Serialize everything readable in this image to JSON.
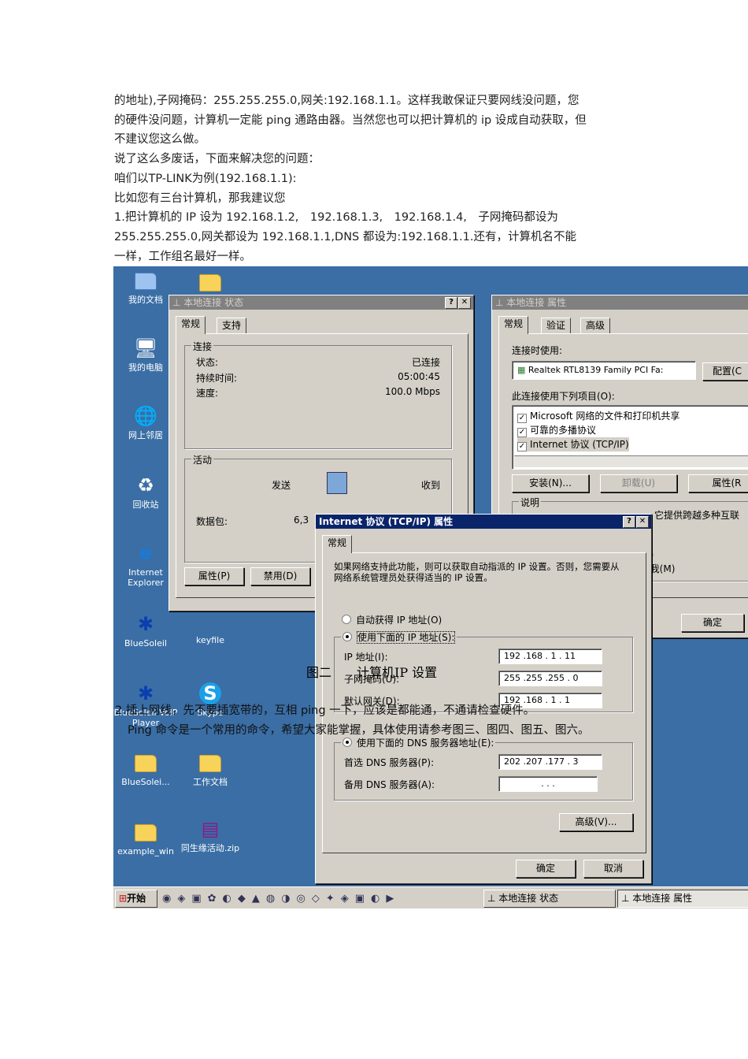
{
  "intro_lines": [
    "的地址),子网掩码：255.255.255.0,网关:192.168.1.1。这样我敢保证只要网线没问题，您",
    "的硬件没问题，计算机一定能 ping 通路由器。当然您也可以把计算机的 ip 设成自动获取，但",
    "不建议您这么做。",
    "说了这么多废话，下面来解决您的问题：",
    "咱们以TP-LINK为例(192.168.1.1):",
    "比如您有三台计算机，那我建议您",
    "1.把计算机的 IP 设为 192.168.1.2,　192.168.1.3,　192.168.1.4,　子网掩码都设为",
    "255.255.255.0,网关都设为 192.168.1.1,DNS 都设为:192.168.1.1.还有，计算机名不能",
    "一样，工作组名最好一样。"
  ],
  "desktop_icons": [
    {
      "label": "我的文档",
      "icon": "my-documents-icon"
    },
    {
      "label": "我的电脑",
      "icon": "my-computer-icon"
    },
    {
      "label": "网上邻居",
      "icon": "network-icon"
    },
    {
      "label": "回收站",
      "icon": "recycle-bin-icon"
    },
    {
      "label": "Internet Explorer",
      "icon": "ie-icon"
    },
    {
      "label": "BlueSoleil",
      "icon": "bluetooth-icon"
    },
    {
      "label": "keyfile",
      "icon": "folder-icon"
    },
    {
      "label": "BlueSoleil VoIP Player",
      "icon": "bluetooth-icon"
    },
    {
      "label": "Skype",
      "icon": "skype-icon"
    },
    {
      "label": "BlueSolei...",
      "icon": "folder-icon"
    },
    {
      "label": "工作文档",
      "icon": "folder-icon"
    },
    {
      "label": "example_win",
      "icon": "folder-icon"
    },
    {
      "label": "同生缘活动.zip",
      "icon": "winrar-icon"
    }
  ],
  "status_dialog": {
    "title": "本地连接 状态",
    "tabs": [
      "常规",
      "支持"
    ],
    "connection_group": "连接",
    "rows": [
      {
        "label": "状态:",
        "value": "已连接"
      },
      {
        "label": "持续时间:",
        "value": "05:00:45"
      },
      {
        "label": "速度:",
        "value": "100.0 Mbps"
      }
    ],
    "activity_group": "活动",
    "sent": "发送",
    "received": "收到",
    "packets_label": "数据包:",
    "packets_sent": "6,3",
    "buttons": [
      "属性(P)",
      "禁用(D)"
    ]
  },
  "props_dialog": {
    "title": "本地连接 属性",
    "tabs": [
      "常规",
      "验证",
      "高级"
    ],
    "connect_using": "连接时使用:",
    "adapter": "Realtek RTL8139 Family PCI Fa:",
    "configure": "配置(C",
    "items_label": "此连接使用下列项目(O):",
    "items": [
      "Microsoft 网络的文件和打印机共享",
      "可靠的多播协议",
      "Internet 协议 (TCP/IP)"
    ],
    "buttons": [
      "安装(N)...",
      "卸载(U)",
      "属性(R"
    ],
    "desc_group": "说明",
    "desc_text": "它提供跨越多种互联",
    "side_fragments": [
      "))",
      "[我(M)"
    ],
    "ok": "确定"
  },
  "tcpip_dialog": {
    "title": "Internet 协议 (TCP/IP) 属性",
    "tab": "常规",
    "info": "如果网络支持此功能，则可以获取自动指派的 IP 设置。否则，您需要从网络系统管理员处获得适当的 IP 设置。",
    "auto_ip": "自动获得 IP 地址(O)",
    "manual_ip": "使用下面的 IP 地址(S):",
    "ip_label": "IP 地址(I):",
    "ip_value": "192 .168 . 1 . 11",
    "mask_label": "子网掩码(U):",
    "mask_value": "255 .255 .255 . 0",
    "gw_label": "默认网关(D):",
    "gw_value": "192 .168 . 1 . 1",
    "manual_dns": "使用下面的 DNS 服务器地址(E):",
    "pref_dns_label": "首选 DNS 服务器(P):",
    "pref_dns_value": "202 .207 .177 . 3",
    "alt_dns_label": "备用 DNS 服务器(A):",
    "alt_dns_value": " .  .  .",
    "advanced": "高级(V)...",
    "ok": "确定",
    "cancel": "取消"
  },
  "figure_caption": "图二　　计算机IP 设置",
  "overlay_line1": "2.插上网线，先不要插宽带的，互相 ping 一下，应该是都能通，不通请检查硬件。",
  "overlay_line2": "Ping 命令是一个常用的命令，希望大家能掌握，具体使用请参考图三、图四、图五、图六。",
  "taskbar": {
    "start": "开始",
    "tasks": [
      "本地连接 状态",
      "本地连接 属性"
    ]
  }
}
